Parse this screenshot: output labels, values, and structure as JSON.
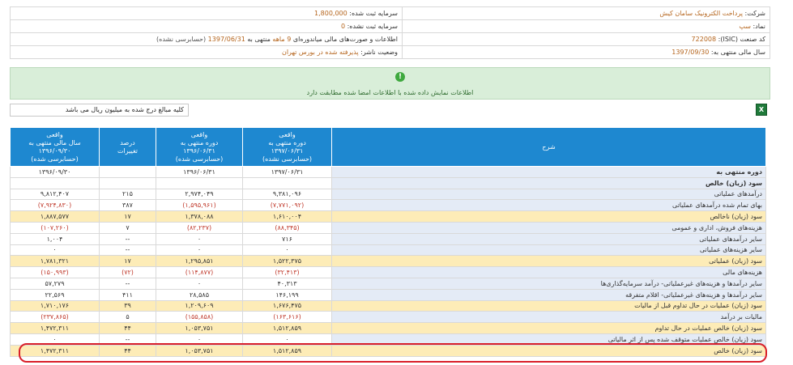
{
  "info": {
    "company_label": "شرکت:",
    "company_value": "پرداخت الکترونیک سامان کیش",
    "reg_capital_label": "سرمایه ثبت شده:",
    "reg_capital_value": "1,800,000",
    "symbol_label": "نماد:",
    "symbol_value": "سپ",
    "unreg_capital_label": "سرمایه ثبت نشده:",
    "unreg_capital_value": "0",
    "isic_label": "کد صنعت (ISIC):",
    "isic_value": "722008",
    "report_prefix": "اطلاعات و صورت‌های مالی میاندوره‌ای",
    "report_period": "9 ماهه",
    "report_mid": "منتهی به",
    "report_date": "1397/06/31",
    "report_status": "(حسابرسی نشده)",
    "fiscal_label": "سال مالی منتهی به:",
    "fiscal_value": "1397/09/30",
    "publisher_label": "وضعیت ناشر:",
    "publisher_value": "پذیرفته شده در بورس تهران"
  },
  "banner": {
    "icon": "check-icon",
    "message": "اطلاعات نمایش داده شده با اطلاعات امضا شده مطابقت دارد"
  },
  "toolbar": {
    "unit_note": "کلیه مبالغ درج شده به میلیون ریال می باشد",
    "excel_icon": "excel-icon"
  },
  "table": {
    "headers": {
      "desc": "شرح",
      "col1": [
        "واقعی",
        "دوره منتهی به",
        "۱۳۹۷/۰۶/۳۱",
        "(حسابرسی نشده)"
      ],
      "col2": [
        "واقعی",
        "دوره منتهی به",
        "۱۳۹۶/۰۶/۳۱",
        "(حسابرسی شده)"
      ],
      "col3": [
        "درصد",
        "تغییرات"
      ],
      "col4": [
        "واقعی",
        "سال مالی منتهی به",
        "۱۳۹۶/۰۹/۳۰",
        "(حسابرسی شده)"
      ]
    },
    "rows": [
      {
        "desc": "دوره منتهی به",
        "v1": "۱۳۹۷/۰۶/۳۱",
        "v2": "۱۳۹۶/۰۶/۳۱",
        "pct": "",
        "v3": "۱۳۹۶/۰۹/۳۰",
        "type": "normal",
        "bold": true
      },
      {
        "desc": "سود (زیان) خالص",
        "v1": "",
        "v2": "",
        "pct": "",
        "v3": "",
        "type": "normal",
        "bold": true
      },
      {
        "desc": "درآمدهای عملیاتی",
        "v1": "۹,۳۸۱,۰۹۶",
        "v2": "۲,۹۷۴,۰۴۹",
        "pct": "۲۱۵",
        "v3": "۹,۸۱۲,۴۰۷",
        "type": "normal"
      },
      {
        "desc": "بهای تمام شده درآمدهای عملیاتی",
        "v1": "(۷,۷۷۱,۰۹۲)",
        "v2": "(۱,۵۹۵,۹۶۱)",
        "pct": "۳۸۷",
        "v3": "(۷,۹۲۴,۸۳۰)",
        "type": "normal",
        "neg": true
      },
      {
        "desc": "سود (زیان) ناخالص",
        "v1": "۱,۶۱۰,۰۰۴",
        "v2": "۱,۳۷۸,۰۸۸",
        "pct": "۱۷",
        "v3": "۱,۸۸۷,۵۷۷",
        "type": "sum"
      },
      {
        "desc": "هزینه‌های فروش، اداری و عمومی",
        "v1": "(۸۸,۳۴۵)",
        "v2": "(۸۲,۲۳۷)",
        "pct": "۷",
        "v3": "(۱۰۷,۲۶۰)",
        "type": "normal",
        "neg": true
      },
      {
        "desc": "سایر درآمدهای عملیاتی",
        "v1": "۷۱۶",
        "v2": "۰",
        "pct": "--",
        "v3": "۱,۰۰۴",
        "type": "normal"
      },
      {
        "desc": "سایر هزینه‌های عملیاتی",
        "v1": "۰",
        "v2": "۰",
        "pct": "--",
        "v3": "۰",
        "type": "normal"
      },
      {
        "desc": "سود (زیان) عملیاتی",
        "v1": "۱,۵۲۲,۳۷۵",
        "v2": "۱,۲۹۵,۸۵۱",
        "pct": "۱۷",
        "v3": "۱,۷۸۱,۳۲۱",
        "type": "sum"
      },
      {
        "desc": "هزینه‌های مالی",
        "v1": "(۳۲,۴۱۳)",
        "v2": "(۱۱۴,۸۷۷)",
        "pct": "(۷۲)",
        "v3": "(۱۵۰,۹۹۳)",
        "type": "normal",
        "neg": true
      },
      {
        "desc": "سایر درآمدها و هزینه‌های غیرعملیاتی- درآمد سرمایه‌گذاری‌ها",
        "v1": "۴۰,۳۱۳",
        "v2": "۰",
        "pct": "--",
        "v3": "۵۷,۲۷۹",
        "type": "normal"
      },
      {
        "desc": "سایر درآمدها و هزینه‌های غیرعملیاتی- اقلام متفرقه",
        "v1": "۱۴۶,۱۹۹",
        "v2": "۲۸,۵۸۵",
        "pct": "۴۱۱",
        "v3": "۲۲,۵۶۹",
        "type": "normal"
      },
      {
        "desc": "سود (زیان) عملیات در حال تداوم قبل از مالیات",
        "v1": "۱,۶۷۶,۴۷۵",
        "v2": "۱,۲۰۹,۶۰۹",
        "pct": "۳۹",
        "v3": "۱,۷۱۰,۱۷۶",
        "type": "sum"
      },
      {
        "desc": "مالیات بر درآمد",
        "v1": "(۱۶۳,۶۱۶)",
        "v2": "(۱۵۵,۸۵۸)",
        "pct": "۵",
        "v3": "(۲۳۷,۸۶۵)",
        "type": "normal",
        "neg": true
      },
      {
        "desc": "سود (زیان) خالص عملیات در حال تداوم",
        "v1": "۱,۵۱۲,۸۵۹",
        "v2": "۱,۰۵۳,۷۵۱",
        "pct": "۴۴",
        "v3": "۱,۴۷۲,۳۱۱",
        "type": "sum"
      },
      {
        "desc": "سود (زیان) خالص عملیات متوقف شده پس از اثر مالیاتی",
        "v1": "۰",
        "v2": "۰",
        "pct": "--",
        "v3": "۰",
        "type": "normal"
      },
      {
        "desc": "سود (زیان) خالص",
        "v1": "۱,۵۱۲,۸۵۹",
        "v2": "۱,۰۵۳,۷۵۱",
        "pct": "۴۴",
        "v3": "۱,۴۷۲,۳۱۱",
        "type": "sum"
      }
    ]
  }
}
